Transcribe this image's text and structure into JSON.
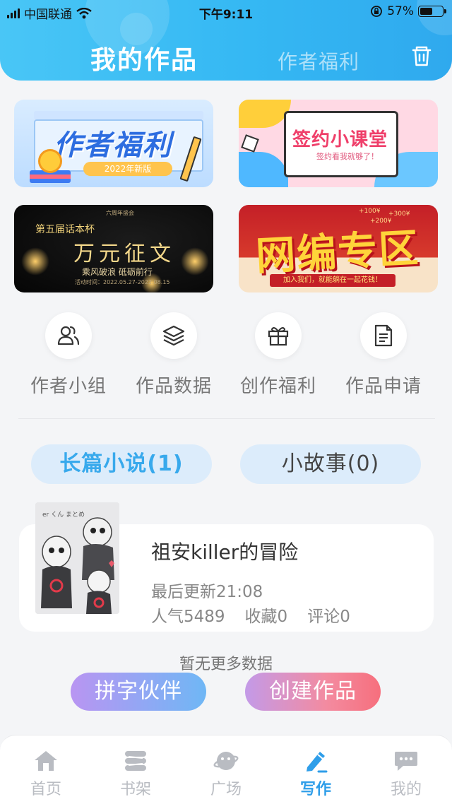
{
  "status_bar": {
    "carrier": "中国联通",
    "time": "下午9:11",
    "battery": "57%",
    "battery_level": 0.57
  },
  "header": {
    "tabs": [
      {
        "label": "我的作品",
        "active": true
      },
      {
        "label": "作者福利",
        "active": false
      }
    ],
    "trash_icon": "trash-icon"
  },
  "banners": [
    {
      "name": "author-benefits-banner",
      "title": "作者福利",
      "tag": "2022年新版"
    },
    {
      "name": "signing-class-banner",
      "title": "签约小课堂",
      "subtitle": "签约看我就够了！"
    },
    {
      "name": "essay-contest-banner",
      "title_top": "第五届话本杯",
      "title": "万元征文",
      "subtitle": "乘风破浪 砥砺前行",
      "date": "活动时间：2022.05.27-2022.08.15",
      "header_small": "六周年盛会"
    },
    {
      "name": "web-serial-banner",
      "title": "网编专区",
      "ribbon": "加入我们，就能躺在一起花钱！",
      "prizes": [
        "+100¥",
        "+300¥",
        "+200¥"
      ]
    }
  ],
  "quick_actions": [
    {
      "label": "作者小组",
      "icon": "people-icon"
    },
    {
      "label": "作品数据",
      "icon": "layers-icon"
    },
    {
      "label": "创作福利",
      "icon": "gift-icon"
    },
    {
      "label": "作品申请",
      "icon": "document-icon"
    }
  ],
  "category_tabs": [
    {
      "label": "长篇小说(1)",
      "active": true
    },
    {
      "label": "小故事(0)",
      "active": false
    }
  ],
  "works": [
    {
      "title": "祖安killer的冒险",
      "last_update": "最后更新21:08",
      "popularity": "人气5489",
      "favorites": "收藏0",
      "comments": "评论0",
      "cover_text": "er くん まとめ"
    }
  ],
  "empty_hint": "暂无更多数据",
  "buttons": {
    "partner": "拼字伙伴",
    "create": "创建作品"
  },
  "bottom_nav": [
    {
      "label": "首页",
      "icon": "home-icon",
      "active": false
    },
    {
      "label": "书架",
      "icon": "bookshelf-icon",
      "active": false
    },
    {
      "label": "广场",
      "icon": "plaza-icon",
      "active": false
    },
    {
      "label": "写作",
      "icon": "pen-icon",
      "active": true
    },
    {
      "label": "我的",
      "icon": "chat-bubble-icon",
      "active": false
    }
  ],
  "colors": {
    "accent": "#35b8f3",
    "active_nav": "#2f9ee9",
    "inactive_nav": "#b9bcc2"
  }
}
